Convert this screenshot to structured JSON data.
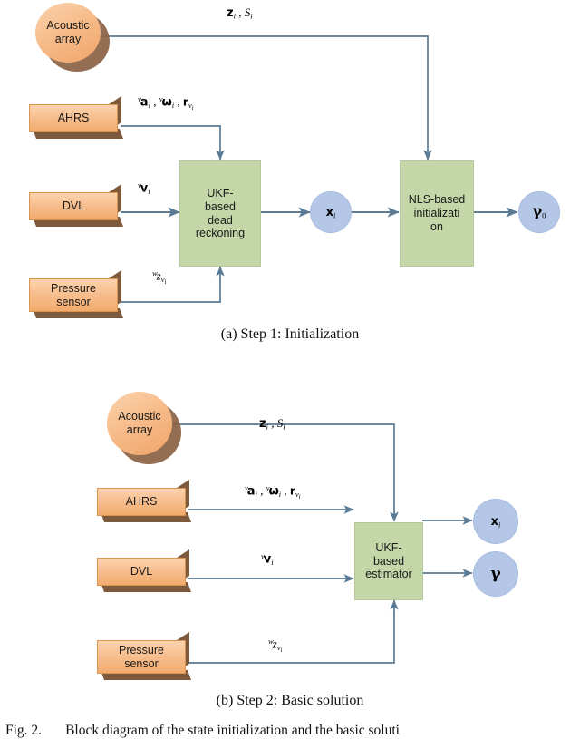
{
  "figure": {
    "caption_a": "(a) Step 1: Initialization",
    "caption_b": "(b) Step 2: Basic solution",
    "fig_label": "Fig. 2.",
    "fig_text": "Block diagram of the state initialization and the basic soluti"
  },
  "colors": {
    "sensor_fill": "#f7bf8f",
    "sensor_shadow": "#8a6244",
    "process_fill": "#c5d6a8",
    "output_fill": "#b4c7e7",
    "connector": "#5b7a93",
    "text": "#1a1a1a"
  },
  "panel_a": {
    "title": "(a) Step 1: Initialization",
    "sensors": [
      {
        "name": "acoustic-array",
        "label": "Acoustic\narray",
        "shape": "ellipse"
      },
      {
        "name": "ahrs",
        "label": "AHRS",
        "shape": "box3d"
      },
      {
        "name": "dvl",
        "label": "DVL",
        "shape": "box3d"
      },
      {
        "name": "pressure-sensor",
        "label": "Pressure\nsensor",
        "shape": "box3d"
      }
    ],
    "processes": [
      {
        "name": "ukf-dead-reckoning",
        "label": "UKF-\nbased\ndead\nreckoning"
      },
      {
        "name": "nls-initialization",
        "label": "NLS-based\ninitializati\non"
      }
    ],
    "outputs": [
      {
        "name": "state-xi",
        "label": "x_i"
      },
      {
        "name": "gamma-zero",
        "label": "γ_0"
      }
    ],
    "edge_labels": {
      "acoustic": "z_i , S_i",
      "ahrs": "^v a_i , ^v ω_i , r_{v_i}",
      "dvl": "^v v_i",
      "pressure": "^w z_{v_i}"
    }
  },
  "panel_b": {
    "title": "(b) Step 2: Basic solution",
    "sensors": [
      {
        "name": "acoustic-array",
        "label": "Acoustic\narray",
        "shape": "ellipse"
      },
      {
        "name": "ahrs",
        "label": "AHRS",
        "shape": "box3d"
      },
      {
        "name": "dvl",
        "label": "DVL",
        "shape": "box3d"
      },
      {
        "name": "pressure-sensor",
        "label": "Pressure\nsensor",
        "shape": "box3d"
      }
    ],
    "processes": [
      {
        "name": "ukf-estimator",
        "label": "UKF-\nbased\nestimator"
      }
    ],
    "outputs": [
      {
        "name": "state-xi",
        "label": "x_i"
      },
      {
        "name": "gamma",
        "label": "γ"
      }
    ],
    "edge_labels": {
      "acoustic": "z_i , S_i",
      "ahrs": "^v a_i , ^v ω_i , r_{v_i}",
      "dvl": "^v v_i",
      "pressure": "^w z_{v_i}"
    }
  },
  "labels": {
    "acoustic_array_l1": "Acoustic",
    "acoustic_array_l2": "array",
    "ahrs": "AHRS",
    "dvl": "DVL",
    "pressure_l1": "Pressure",
    "pressure_l2": "sensor",
    "ukf_dr_l1": "UKF-",
    "ukf_dr_l2": "based",
    "ukf_dr_l3": "dead",
    "ukf_dr_l4": "reckoning",
    "nls_l1": "NLS-based",
    "nls_l2": "initializati",
    "nls_l3": "on",
    "ukf_est_l1": "UKF-",
    "ukf_est_l2": "based",
    "ukf_est_l3": "estimator"
  }
}
